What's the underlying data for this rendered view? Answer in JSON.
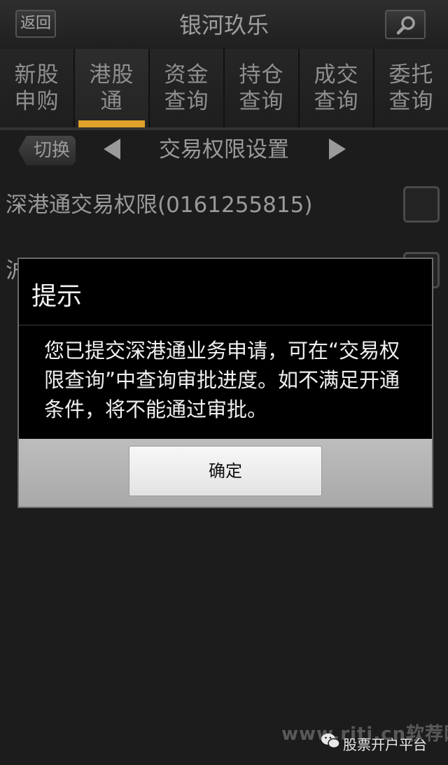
{
  "header": {
    "back_label": "返回",
    "title": "银河玖乐"
  },
  "tabs": [
    {
      "label": "新股申购",
      "active": false
    },
    {
      "label": "港股通",
      "active": true
    },
    {
      "label": "资金查询",
      "active": false
    },
    {
      "label": "持仓查询",
      "active": false
    },
    {
      "label": "成交查询",
      "active": false
    },
    {
      "label": "委托查询",
      "active": false
    }
  ],
  "subheader": {
    "switch_label": "切换",
    "title": "交易权限设置"
  },
  "rows": [
    {
      "label": "深港通交易权限(0161255815)"
    },
    {
      "label": "沪"
    }
  ],
  "dialog": {
    "title": "提示",
    "message": "您已提交深港通业务申请，可在“交易权限查询”中查询审批进度。如不满足开通条件，将不能通过审批。",
    "ok_label": "确定"
  },
  "watermark": {
    "url": "www.riti.cn软荐网",
    "source": "股票开户平台"
  },
  "colors": {
    "active_tab_indicator": "#e0a12a",
    "background": "#1c1c1c"
  }
}
